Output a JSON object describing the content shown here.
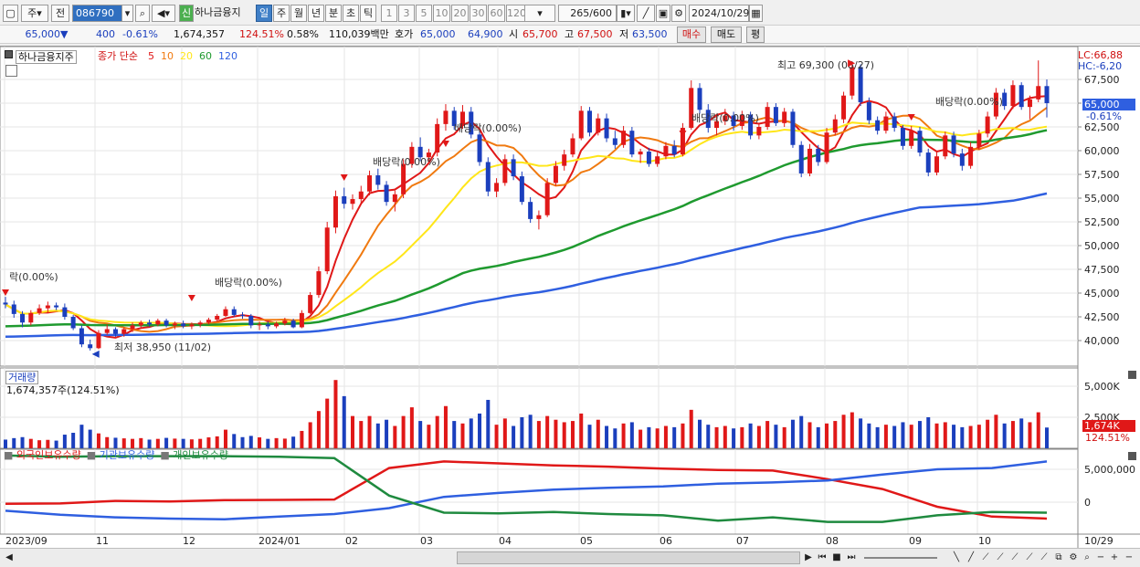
{
  "toolbar": {
    "market_select": "주",
    "prefix_btn": "전",
    "stock_code": "086790",
    "stock_badge": "신",
    "stock_name": "하나금융지",
    "period_tabs": [
      "일",
      "주",
      "월",
      "년",
      "분",
      "초",
      "틱"
    ],
    "interval_btns": [
      "1",
      "3",
      "5",
      "10",
      "20",
      "30",
      "60",
      "120"
    ],
    "count_value": "265",
    "count_total": "/600",
    "date_value": "2024/10/29"
  },
  "quote": {
    "price": "65,000",
    "change_arrow": "▼",
    "change": "400",
    "change_pct": "-0.61%",
    "volume": "1,674,357",
    "volume_ratio": "124.51%",
    "turnover_pct": "0.58%",
    "amount": "110,039백만",
    "hoga_label": "호가",
    "ask": "65,000",
    "bid": "64,900",
    "open_label": "시",
    "open": "65,700",
    "high_label": "고",
    "high": "67,500",
    "low_label": "저",
    "low": "63,500",
    "buy_btn": "매수",
    "sell_btn": "매도",
    "avg_btn": "평"
  },
  "price_panel": {
    "title": "하나금융지주",
    "ma_label": "종가 단순",
    "ma_periods": [
      "5",
      "10",
      "20",
      "60",
      "120"
    ],
    "ma_colors": [
      "#e01818",
      "#f07a10",
      "#ffe619",
      "#1f9a2f",
      "#2f5fe0"
    ],
    "lc": "LC:66,88",
    "hc": "HC:-6,20",
    "annotations": [
      "락(0.00%)",
      "배당락(0.00%)",
      "배당락(0.00%)",
      "배당락(0.00%)",
      "배당락(0.00%)",
      "배당락(0.00%)",
      "최저 38,950 (11/02)",
      "최고 69,300 (08/27)"
    ],
    "y_ticks": [
      "67,500",
      "65,000",
      "62,500",
      "60,000",
      "57,500",
      "55,000",
      "52,500",
      "50,000",
      "47,500",
      "45,000",
      "42,500",
      "40,000"
    ],
    "last_price": "65,000",
    "last_pct": "-0.61%"
  },
  "volume_panel": {
    "title": "거래량",
    "value": "1,674,357주(124.51%)",
    "y_ticks": [
      "5,000K",
      "2,500K"
    ],
    "last_value": "1,674K",
    "last_pct": "124.51%"
  },
  "holding_panel": {
    "legend": [
      "외국인보유수량",
      "기관보유수량",
      "개인보유수량"
    ],
    "colors": [
      "#e01818",
      "#2f5fe0",
      "#1f8a3f"
    ],
    "y_ticks": [
      "5,000,000",
      "0"
    ]
  },
  "x_axis": {
    "labels": [
      "2023/09",
      "11",
      "12",
      "2024/01",
      "02",
      "03",
      "04",
      "05",
      "06",
      "07",
      "08",
      "09",
      "10"
    ],
    "end_label": "10/29"
  },
  "chart_data": {
    "type": "candlestick",
    "candles": [
      [
        44,
        44.6,
        43.4,
        43.8
      ],
      [
        43.8,
        44.2,
        42.4,
        42.8
      ],
      [
        42.8,
        43.1,
        41.4,
        41.9
      ],
      [
        41.9,
        43.2,
        41.6,
        42.9
      ],
      [
        42.9,
        43.8,
        42.7,
        43.4
      ],
      [
        43.4,
        44.1,
        42.9,
        43.7
      ],
      [
        43.7,
        44,
        43.2,
        43.5
      ],
      [
        43.5,
        43.9,
        42.2,
        42.5
      ],
      [
        42.5,
        42.7,
        41.1,
        41.3
      ],
      [
        41.3,
        41.6,
        39.3,
        39.6
      ],
      [
        39.6,
        40.1,
        38.95,
        39.2
      ],
      [
        39.2,
        41.1,
        39.1,
        40.8
      ],
      [
        40.8,
        41.7,
        40.6,
        41.2
      ],
      [
        41.2,
        41.4,
        40.4,
        40.7
      ],
      [
        40.7,
        41.4,
        40.4,
        41.2
      ],
      [
        41.2,
        41.9,
        40.9,
        41.6
      ],
      [
        41.6,
        42.1,
        41.3,
        41.9
      ],
      [
        41.9,
        42.2,
        41.5,
        41.7
      ],
      [
        41.7,
        42.3,
        41.5,
        42.1
      ],
      [
        42.1,
        42.3,
        41.4,
        41.6
      ],
      [
        41.6,
        42,
        41.2,
        41.8
      ],
      [
        41.8,
        42.1,
        41.3,
        41.5
      ],
      [
        41.5,
        41.9,
        41.2,
        41.7
      ],
      [
        41.7,
        42.1,
        41.4,
        41.9
      ],
      [
        41.9,
        42.4,
        41.7,
        42.2
      ],
      [
        42.2,
        42.8,
        42,
        42.6
      ],
      [
        42.6,
        43.6,
        42.5,
        43.3
      ],
      [
        43.3,
        43.6,
        42.5,
        42.7
      ],
      [
        42.7,
        43,
        42.3,
        42.6
      ],
      [
        42.6,
        42.8,
        41.3,
        41.6
      ],
      [
        41.6,
        42,
        41.1,
        41.7
      ],
      [
        41.7,
        42,
        41.2,
        41.5
      ],
      [
        41.5,
        42,
        41.3,
        41.8
      ],
      [
        41.8,
        42.4,
        41.6,
        42.1
      ],
      [
        42.1,
        42.3,
        41.3,
        41.4
      ],
      [
        41.4,
        43.2,
        41.3,
        42.9
      ],
      [
        42.9,
        45.1,
        42.8,
        44.8
      ],
      [
        44.8,
        47.8,
        44.5,
        47.3
      ],
      [
        47.3,
        52.5,
        47,
        51.9
      ],
      [
        51.9,
        55.8,
        51.3,
        55.2
      ],
      [
        55.2,
        56.1,
        53.9,
        54.4
      ],
      [
        54.4,
        55.4,
        53.8,
        54.9
      ],
      [
        54.9,
        56.3,
        54.5,
        55.7
      ],
      [
        55.7,
        57.9,
        55.3,
        57.4
      ],
      [
        57.4,
        58.1,
        55.9,
        56.4
      ],
      [
        56.4,
        56.8,
        54.2,
        54.6
      ],
      [
        54.6,
        55.8,
        53.6,
        55.4
      ],
      [
        55.4,
        59.1,
        55,
        58.6
      ],
      [
        58.6,
        60.9,
        58.2,
        60.4
      ],
      [
        60.4,
        61.4,
        58.9,
        59.3
      ],
      [
        59.3,
        60.2,
        58.6,
        59.8
      ],
      [
        59.8,
        63.4,
        59.4,
        62.8
      ],
      [
        62.8,
        64.9,
        62.1,
        64.2
      ],
      [
        64.2,
        64.6,
        62.2,
        62.6
      ],
      [
        62.6,
        64.8,
        62.3,
        64.1
      ],
      [
        64.1,
        64.6,
        61.3,
        61.7
      ],
      [
        61.7,
        62.1,
        58.4,
        58.8
      ],
      [
        58.8,
        59.3,
        55.2,
        55.7
      ],
      [
        55.7,
        57.1,
        55.1,
        56.6
      ],
      [
        56.6,
        59.6,
        56.3,
        59.1
      ],
      [
        59.1,
        59.6,
        56.9,
        57.3
      ],
      [
        57.3,
        57.8,
        54.3,
        54.6
      ],
      [
        54.6,
        55.1,
        52.4,
        52.8
      ],
      [
        52.8,
        53.7,
        51.7,
        53.2
      ],
      [
        53.2,
        57.1,
        53,
        56.6
      ],
      [
        56.6,
        58.9,
        56.3,
        58.4
      ],
      [
        58.4,
        60.1,
        57.9,
        59.6
      ],
      [
        59.6,
        61.8,
        59.3,
        61.3
      ],
      [
        61.3,
        64.7,
        61.1,
        64.2
      ],
      [
        64.2,
        64.6,
        61.5,
        61.9
      ],
      [
        61.9,
        63.9,
        61.6,
        63.4
      ],
      [
        63.4,
        63.9,
        60.9,
        61.3
      ],
      [
        61.3,
        62.1,
        60.2,
        60.6
      ],
      [
        60.6,
        62.6,
        60.3,
        62.1
      ],
      [
        62.1,
        62.5,
        59.3,
        59.6
      ],
      [
        59.6,
        60.2,
        58.7,
        59.9
      ],
      [
        59.9,
        60.3,
        58.3,
        58.6
      ],
      [
        58.6,
        59.8,
        58.3,
        59.4
      ],
      [
        59.4,
        60.9,
        59.1,
        60.5
      ],
      [
        60.5,
        61.1,
        59.3,
        59.6
      ],
      [
        59.6,
        62.9,
        59.4,
        62.4
      ],
      [
        62.4,
        67.4,
        62.2,
        66.6
      ],
      [
        66.6,
        67.1,
        63.9,
        64.3
      ],
      [
        64.3,
        64.9,
        61.9,
        62.4
      ],
      [
        62.4,
        63.7,
        61.6,
        63.1
      ],
      [
        63.1,
        64.4,
        62.7,
        63.7
      ],
      [
        63.7,
        64.1,
        62.1,
        62.6
      ],
      [
        62.6,
        64.2,
        62.2,
        63.8
      ],
      [
        63.8,
        64.1,
        61.2,
        61.6
      ],
      [
        61.6,
        62.9,
        61.2,
        62.5
      ],
      [
        62.5,
        65.1,
        62.2,
        64.6
      ],
      [
        64.6,
        65,
        62.6,
        62.9
      ],
      [
        62.9,
        64.5,
        62.5,
        64.1
      ],
      [
        64.1,
        64.4,
        60.3,
        60.6
      ],
      [
        60.6,
        61,
        57.2,
        57.6
      ],
      [
        57.6,
        60.7,
        57.3,
        60.2
      ],
      [
        60.2,
        60.6,
        58.4,
        58.8
      ],
      [
        58.8,
        62.4,
        58.6,
        61.9
      ],
      [
        61.9,
        63.8,
        61.6,
        63.3
      ],
      [
        63.3,
        66.2,
        62.9,
        65.8
      ],
      [
        65.8,
        69.3,
        65.4,
        68.8
      ],
      [
        68.8,
        69.1,
        64.7,
        65.1
      ],
      [
        65.1,
        65.6,
        62.8,
        63.2
      ],
      [
        63.2,
        63.6,
        61.7,
        62.1
      ],
      [
        62.1,
        64.1,
        61.8,
        63.6
      ],
      [
        63.6,
        64,
        62,
        62.4
      ],
      [
        62.4,
        62.7,
        60.1,
        60.5
      ],
      [
        60.5,
        62.6,
        60.2,
        62.1
      ],
      [
        62.1,
        62.5,
        59.4,
        59.8
      ],
      [
        59.8,
        60.2,
        57.3,
        57.7
      ],
      [
        57.7,
        59.9,
        57.4,
        59.4
      ],
      [
        59.4,
        62,
        59.1,
        61.6
      ],
      [
        61.6,
        62,
        59.3,
        59.7
      ],
      [
        59.7,
        60.2,
        57.9,
        58.4
      ],
      [
        58.4,
        60.9,
        58.1,
        60.4
      ],
      [
        60.4,
        62.2,
        60.1,
        61.8
      ],
      [
        61.8,
        64.1,
        61.4,
        63.6
      ],
      [
        63.6,
        66.6,
        63.3,
        66.1
      ],
      [
        66.1,
        66.5,
        64.3,
        64.7
      ],
      [
        64.7,
        67.4,
        64.4,
        66.9
      ],
      [
        66.9,
        67.2,
        64.3,
        64.6
      ],
      [
        64.6,
        65.8,
        63.3,
        65.4
      ],
      [
        65.4,
        69.5,
        65.1,
        66.8
      ],
      [
        66.8,
        67.5,
        63.5,
        65
      ]
    ],
    "volume_k": [
      700,
      820,
      900,
      760,
      650,
      680,
      620,
      1100,
      1250,
      1900,
      1500,
      1200,
      900,
      850,
      800,
      760,
      820,
      700,
      760,
      840,
      780,
      760,
      720,
      760,
      880,
      960,
      1500,
      1150,
      900,
      1000,
      880,
      760,
      820,
      780,
      940,
      1400,
      2100,
      3000,
      4000,
      5500,
      4200,
      2600,
      2200,
      2600,
      2000,
      2300,
      1800,
      2600,
      3300,
      2200,
      1900,
      2600,
      3400,
      2200,
      2000,
      2400,
      2800,
      3900,
      1900,
      2400,
      1800,
      2500,
      2700,
      2200,
      2600,
      2300,
      2100,
      2200,
      2800,
      1900,
      2300,
      1800,
      1600,
      2000,
      2100,
      1500,
      1700,
      1600,
      1800,
      1700,
      2000,
      3100,
      2300,
      1900,
      1700,
      1800,
      1600,
      1700,
      2000,
      1800,
      2200,
      1900,
      1700,
      2300,
      2600,
      2100,
      1700,
      2000,
      2200,
      2700,
      2900,
      2400,
      2000,
      1700,
      1900,
      1800,
      2100,
      1900,
      2200,
      2500,
      2000,
      2100,
      1900,
      1700,
      1800,
      1900,
      2300,
      2700,
      2000,
      2200,
      2400,
      2100,
      2900,
      1674
    ],
    "holdings": {
      "foreign": [
        -0.25,
        -0.2,
        0.2,
        0.1,
        0.3,
        0.35,
        0.4,
        5.2,
        6.2,
        5.9,
        5.6,
        5.4,
        5.1,
        4.9,
        4.8,
        3.5,
        2.0,
        -0.7,
        -2.2,
        -2.5
      ],
      "institution": [
        -1.3,
        -1.9,
        -2.3,
        -2.5,
        -2.6,
        -2.2,
        -1.8,
        -0.9,
        0.8,
        1.4,
        1.9,
        2.2,
        2.4,
        2.8,
        3.0,
        3.3,
        4.2,
        5.0,
        5.2,
        6.2
      ],
      "individual": [
        7.1,
        6.9,
        7.0,
        7.0,
        7.0,
        6.9,
        6.7,
        1.0,
        -1.6,
        -1.7,
        -1.5,
        -1.8,
        -2.0,
        -2.8,
        -2.3,
        -3.0,
        -3.0,
        -2.0,
        -1.5,
        -1.6
      ]
    }
  }
}
